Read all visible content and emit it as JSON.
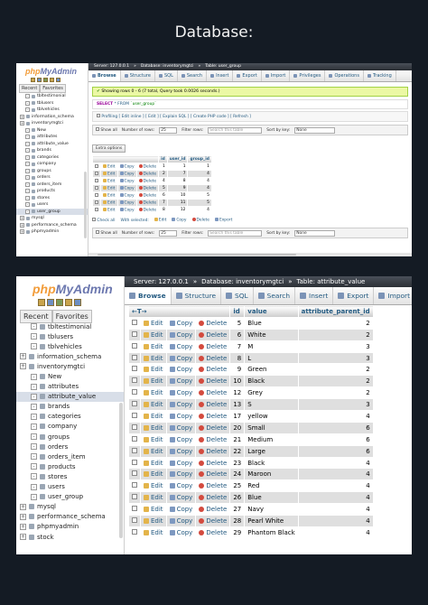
{
  "title": "Database:",
  "nav": {
    "logo_php": "php",
    "logo_myadmin": "MyAdmin",
    "tab_recent": "Recent",
    "tab_favorites": "Favorites"
  },
  "top": {
    "tree": [
      {
        "label": "tbltestimonial",
        "level": 2
      },
      {
        "label": "tblusers",
        "level": 2
      },
      {
        "label": "tblvehicles",
        "level": 2
      },
      {
        "label": "information_schema",
        "level": 1
      },
      {
        "label": "inventorymgtci",
        "level": 1
      },
      {
        "label": "New",
        "level": 2
      },
      {
        "label": "attributes",
        "level": 2
      },
      {
        "label": "attribute_value",
        "level": 2
      },
      {
        "label": "brands",
        "level": 2
      },
      {
        "label": "categories",
        "level": 2
      },
      {
        "label": "company",
        "level": 2
      },
      {
        "label": "groups",
        "level": 2
      },
      {
        "label": "orders",
        "level": 2
      },
      {
        "label": "orders_item",
        "level": 2
      },
      {
        "label": "products",
        "level": 2
      },
      {
        "label": "stores",
        "level": 2
      },
      {
        "label": "users",
        "level": 2
      },
      {
        "label": "user_group",
        "level": 2,
        "selected": true
      },
      {
        "label": "mysql",
        "level": 1
      },
      {
        "label": "performance_schema",
        "level": 1
      },
      {
        "label": "phpmyadmin",
        "level": 1
      }
    ],
    "crumb": [
      "Server: 127.0.0.1",
      "»",
      "Database: inventorymgtci",
      "»",
      "Table: user_group"
    ],
    "tabs": [
      "Browse",
      "Structure",
      "SQL",
      "Search",
      "Insert",
      "Export",
      "Import",
      "Privileges",
      "Operations",
      "Tracking"
    ],
    "alert": "Showing rows 0 - 6 (7 total, Query took 0.0026 seconds.)",
    "sql_select": "SELECT",
    "sql_rest": "* FROM",
    "sql_table": "`user_group`",
    "profiling": "Profiling [ Edit inline ] [ Edit ] [ Explain SQL ] [ Create PHP code ] [ Refresh ]",
    "show_all": "Show all",
    "rows_label": "Number of rows:",
    "rows_value": "25",
    "filter_label": "Filter rows:",
    "filter_placeholder": "Search this table",
    "sort_label": "Sort by key:",
    "sort_value": "None",
    "extra_options": "Extra options",
    "columns": [
      "id",
      "user_id",
      "group_id"
    ],
    "rows": [
      [
        "1",
        "1",
        "1"
      ],
      [
        "2",
        "7",
        "4"
      ],
      [
        "4",
        "8",
        "4"
      ],
      [
        "5",
        "9",
        "4"
      ],
      [
        "6",
        "10",
        "5"
      ],
      [
        "7",
        "11",
        "5"
      ],
      [
        "8",
        "12",
        "4"
      ]
    ],
    "check_all": "Check all",
    "with_selected": "With selected:",
    "bottom_edit": "Edit",
    "bottom_copy": "Copy",
    "bottom_delete": "Delete",
    "bottom_export": "Export"
  },
  "bottom": {
    "tree": [
      {
        "label": "tbltestimonial",
        "level": 2
      },
      {
        "label": "tblusers",
        "level": 2
      },
      {
        "label": "tblvehicles",
        "level": 2
      },
      {
        "label": "information_schema",
        "level": 1
      },
      {
        "label": "inventorymgtci",
        "level": 1
      },
      {
        "label": "New",
        "level": 2
      },
      {
        "label": "attributes",
        "level": 2
      },
      {
        "label": "attribute_value",
        "level": 2,
        "selected": true
      },
      {
        "label": "brands",
        "level": 2
      },
      {
        "label": "categories",
        "level": 2
      },
      {
        "label": "company",
        "level": 2
      },
      {
        "label": "groups",
        "level": 2
      },
      {
        "label": "orders",
        "level": 2
      },
      {
        "label": "orders_item",
        "level": 2
      },
      {
        "label": "products",
        "level": 2
      },
      {
        "label": "stores",
        "level": 2
      },
      {
        "label": "users",
        "level": 2
      },
      {
        "label": "user_group",
        "level": 2
      },
      {
        "label": "mysql",
        "level": 1
      },
      {
        "label": "performance_schema",
        "level": 1
      },
      {
        "label": "phpmyadmin",
        "level": 1
      },
      {
        "label": "stock",
        "level": 1
      }
    ],
    "crumb": [
      "Server: 127.0.0.1",
      "»",
      "Database: inventorymgtci",
      "»",
      "Table: attribute_value"
    ],
    "tabs": [
      "Browse",
      "Structure",
      "SQL",
      "Search",
      "Insert",
      "Export",
      "Import"
    ],
    "arrows": "←T→",
    "columns": [
      "id",
      "value",
      "attribute_parent_id"
    ],
    "rows": [
      [
        "5",
        "Blue",
        "2"
      ],
      [
        "6",
        "White",
        "2"
      ],
      [
        "7",
        "M",
        "3"
      ],
      [
        "8",
        "L",
        "3"
      ],
      [
        "9",
        "Green",
        "2"
      ],
      [
        "10",
        "Black",
        "2"
      ],
      [
        "12",
        "Grey",
        "2"
      ],
      [
        "13",
        "S",
        "3"
      ],
      [
        "17",
        "yellow",
        "4"
      ],
      [
        "20",
        "Small",
        "6"
      ],
      [
        "21",
        "Medium",
        "6"
      ],
      [
        "22",
        "Large",
        "6"
      ],
      [
        "23",
        "Black",
        "4"
      ],
      [
        "24",
        "Maroon",
        "4"
      ],
      [
        "25",
        "Red",
        "4"
      ],
      [
        "26",
        "Blue",
        "4"
      ],
      [
        "27",
        "Navy",
        "4"
      ],
      [
        "28",
        "Pearl White",
        "4"
      ],
      [
        "29",
        "Phantom Black",
        "4"
      ]
    ]
  },
  "row_actions": {
    "edit": "Edit",
    "copy": "Copy",
    "delete": "Delete"
  },
  "colors": {
    "background": "#141b24",
    "link": "#235a81",
    "logo": "#6c78af",
    "alert": "#ebf8a4"
  }
}
